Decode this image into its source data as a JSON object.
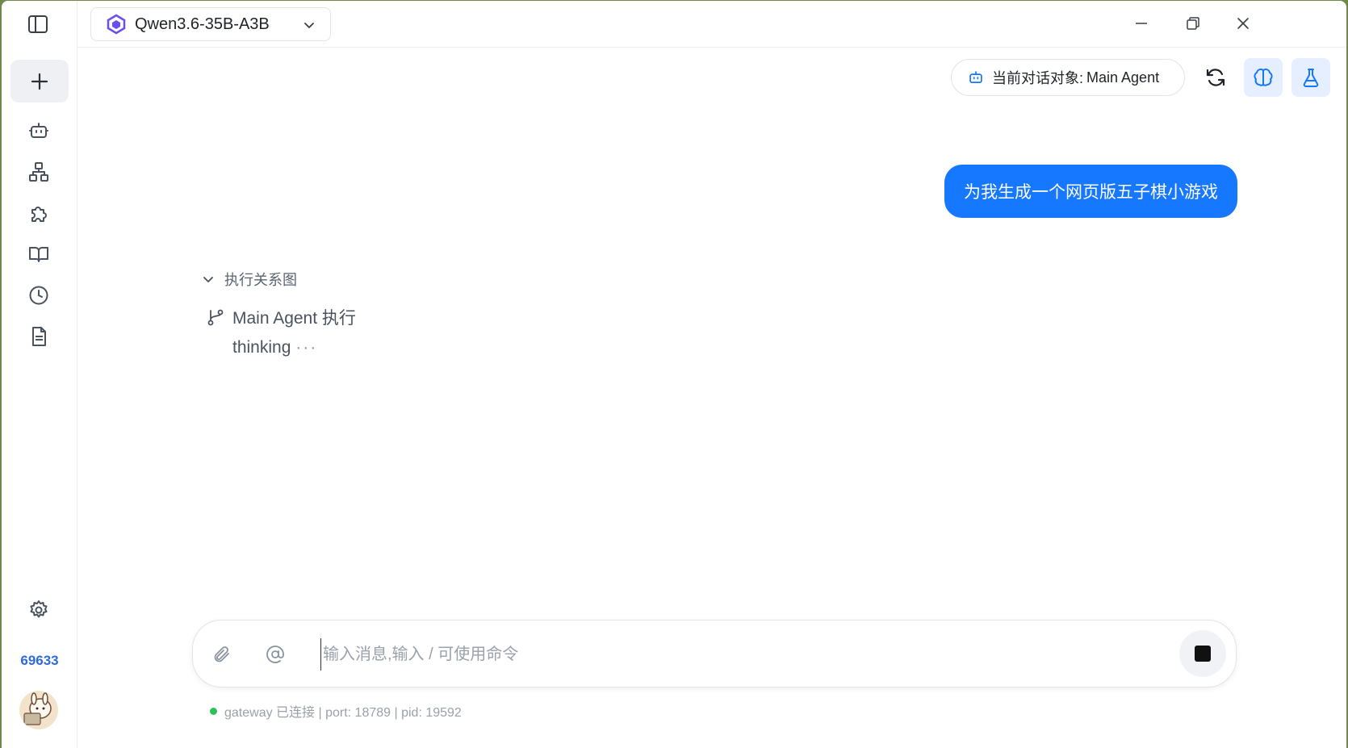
{
  "topbar": {
    "model_name": "Qwen3.6-35B-A3B"
  },
  "sidebar": {
    "count": "69633",
    "items": [
      {
        "icon": "bot-icon"
      },
      {
        "icon": "hierarchy-icon"
      },
      {
        "icon": "puzzle-icon"
      },
      {
        "icon": "book-icon"
      },
      {
        "icon": "clock-icon"
      },
      {
        "icon": "document-icon"
      }
    ]
  },
  "header": {
    "agent_label": "当前对话对象:",
    "agent_value": "Main Agent"
  },
  "chat": {
    "user_message": "为我生成一个网页版五子棋小游戏",
    "exec_graph_label": "执行关系图",
    "exec_node": "Main Agent 执行",
    "thinking": "thinking",
    "thinking_dots": "···"
  },
  "input": {
    "placeholder": "输入消息,输入 / 可使用命令"
  },
  "status": {
    "text": "gateway 已连接 | port: 18789 | pid: 19592",
    "color": "#2fbf5a"
  },
  "colors": {
    "accent": "#1677ff",
    "count": "#2f6bd8"
  }
}
